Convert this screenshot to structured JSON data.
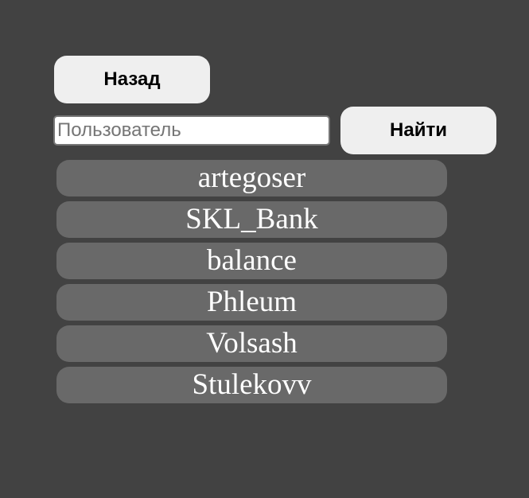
{
  "back_button": {
    "label": "Назад"
  },
  "search": {
    "placeholder": "Пользователь",
    "value": "",
    "button_label": "Найти"
  },
  "users": [
    {
      "name": "artegoser"
    },
    {
      "name": "SKL_Bank"
    },
    {
      "name": "balance"
    },
    {
      "name": "Phleum"
    },
    {
      "name": "Volsash"
    },
    {
      "name": "Stulekovv"
    }
  ],
  "colors": {
    "background": "#424242",
    "button_bg": "#efefef",
    "list_item_bg": "#696969",
    "list_item_text": "#ffffff"
  }
}
